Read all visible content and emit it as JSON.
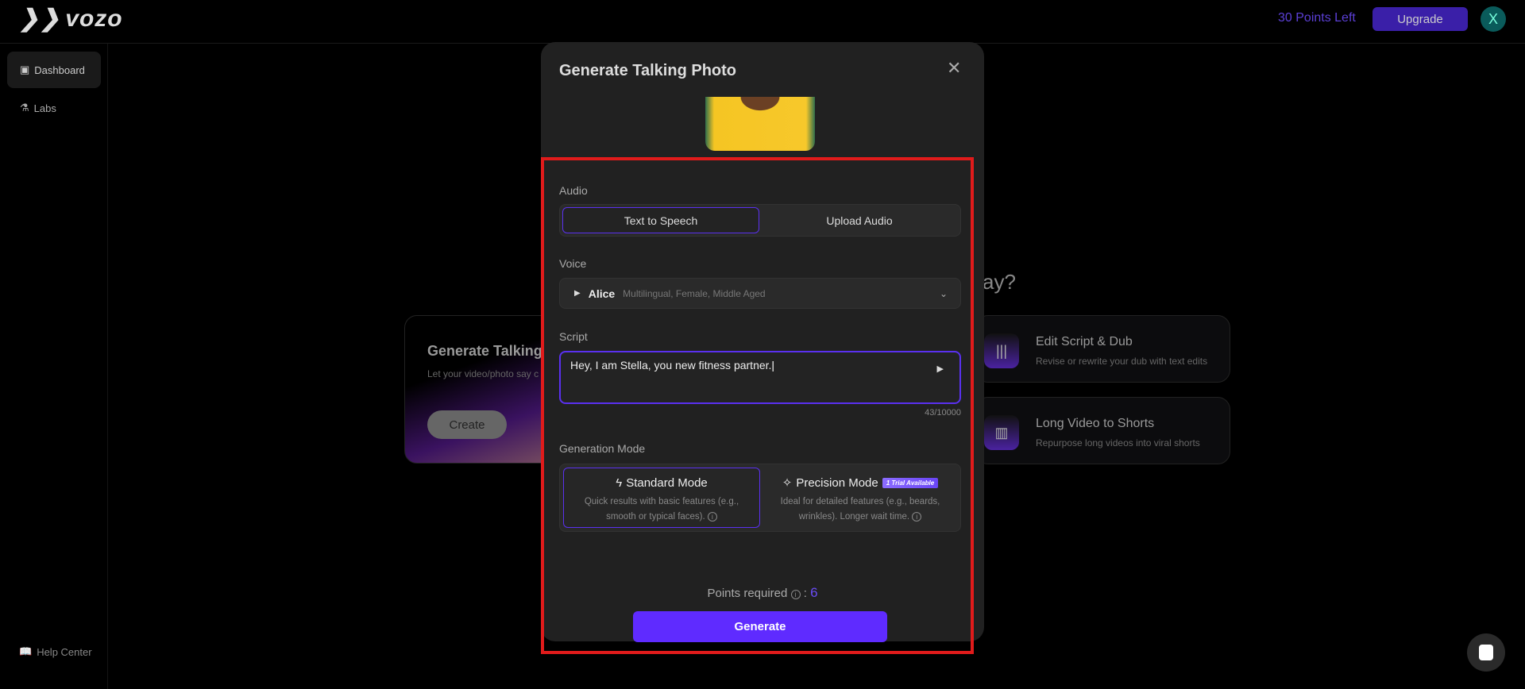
{
  "header": {
    "logo": "vozo",
    "points_left": "30 Points Left",
    "upgrade": "Upgrade",
    "avatar": "X"
  },
  "sidebar": {
    "items": [
      {
        "label": "Dashboard",
        "icon": "layout-icon"
      },
      {
        "label": "Labs",
        "icon": "flask-icon"
      }
    ],
    "help": "Help Center"
  },
  "background": {
    "question_fragment": "ay?",
    "left_card": {
      "title": "Generate Talking V",
      "subtitle": "Let your video/photo say c",
      "button": "Create"
    },
    "cards": [
      {
        "title": "Edit Script & Dub",
        "subtitle": "Revise or rewrite your dub with text edits"
      },
      {
        "title": "Long Video to Shorts",
        "subtitle": "Repurpose long videos into viral shorts"
      }
    ]
  },
  "modal": {
    "title": "Generate Talking Photo",
    "audio": {
      "label": "Audio",
      "options": [
        "Text to Speech",
        "Upload Audio"
      ],
      "selected": "Text to Speech"
    },
    "voice": {
      "label": "Voice",
      "name": "Alice",
      "description": "Multilingual, Female, Middle Aged"
    },
    "script": {
      "label": "Script",
      "value": "Hey, I am Stella, you new fitness partner.",
      "counter": "43/10000"
    },
    "generation_mode": {
      "label": "Generation Mode",
      "selected": "Standard Mode",
      "modes": [
        {
          "title": "Standard Mode",
          "description": "Quick results with basic features (e.g., smooth or typical faces)."
        },
        {
          "title": "Precision Mode",
          "badge": "1 Trial Available",
          "description": "Ideal for detailed features (e.g., beards, wrinkles). Longer wait time."
        }
      ]
    },
    "points_required_label": "Points required",
    "points_required": "6",
    "generate": "Generate"
  },
  "colors": {
    "accent": "#5f2bff",
    "highlight": "#e01b1b"
  }
}
